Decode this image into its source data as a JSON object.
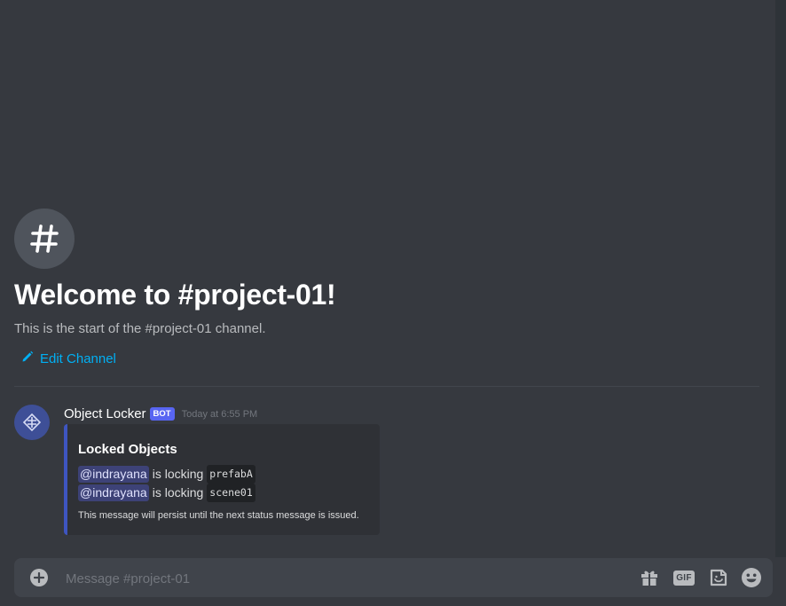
{
  "welcome": {
    "title": "Welcome to #project-01!",
    "subtitle": "This is the start of the #project-01 channel.",
    "edit_channel_label": "Edit Channel"
  },
  "message": {
    "username": "Object Locker",
    "bot_tag": "BOT",
    "timestamp": "Today at 6:55 PM",
    "embed": {
      "title": "Locked Objects",
      "lines": [
        {
          "mention": "@indrayana",
          "text": "is locking",
          "object": "prefabA"
        },
        {
          "mention": "@indrayana",
          "text": "is locking",
          "object": "scene01"
        }
      ],
      "footer": "This message will persist until the next status message is issued."
    }
  },
  "composer": {
    "placeholder": "Message #project-01",
    "gif_label": "GIF"
  },
  "icons": {
    "channel": "hash-icon",
    "edit": "pencil-icon",
    "avatar": "bot-avatar-icon",
    "attach": "plus-circle-icon",
    "gift": "gift-icon",
    "gif": "gif-icon",
    "sticker": "sticker-icon",
    "emoji": "emoji-icon"
  },
  "colors": {
    "background": "#36393f",
    "link": "#00b0f4",
    "bot_tag": "#5865f2",
    "embed_border": "#3e55c0"
  }
}
